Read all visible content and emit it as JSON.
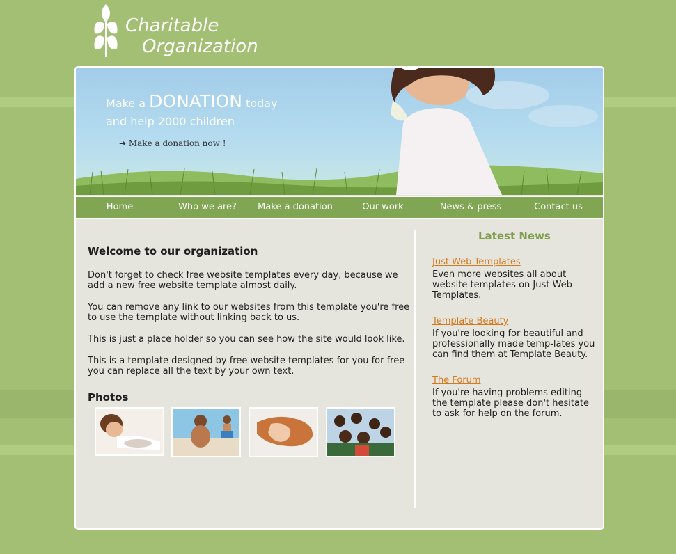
{
  "logo": {
    "line1": "Charitable",
    "line2": "Organization"
  },
  "hero": {
    "line1_prefix": "Make a",
    "line1_big": "DONATION",
    "line1_suffix": "today",
    "line2": "and help 2000 children",
    "link": "➔ Make a donation now !"
  },
  "nav": {
    "items": [
      "Home",
      "Who we are?",
      "Make a donation",
      "Our work",
      "News & press",
      "Contact us"
    ]
  },
  "main": {
    "title": "Welcome to our organization",
    "paragraphs": [
      "Don't forget to check free website templates every day, because we add a new free website template almost daily.",
      "You can remove any link to our websites from this template you're free to use the template without linking back to us.",
      "This is just a place holder so you can see how the site would look like.",
      "This is a template designed by free website templates for you for free you can replace all the text by your own text."
    ],
    "photos_title": "Photos"
  },
  "sidebar": {
    "title": "Latest News",
    "news": [
      {
        "title": "Just Web Templates",
        "text": "Even more websites all about website templates on Just Web Templates."
      },
      {
        "title": "Template Beauty",
        "text": "If you're looking for beautiful and professionally made temp-lates you can find them at Template Beauty."
      },
      {
        "title": "The Forum",
        "text": "If you're having problems editing the template please don't hesitate to ask for help on the forum."
      }
    ]
  },
  "colors": {
    "background": "#a2bf74",
    "nav": "#80a653",
    "accent_link": "#d37a1e",
    "sidebar_title": "#7f9f4f",
    "content_bg": "#e5e5dd"
  }
}
